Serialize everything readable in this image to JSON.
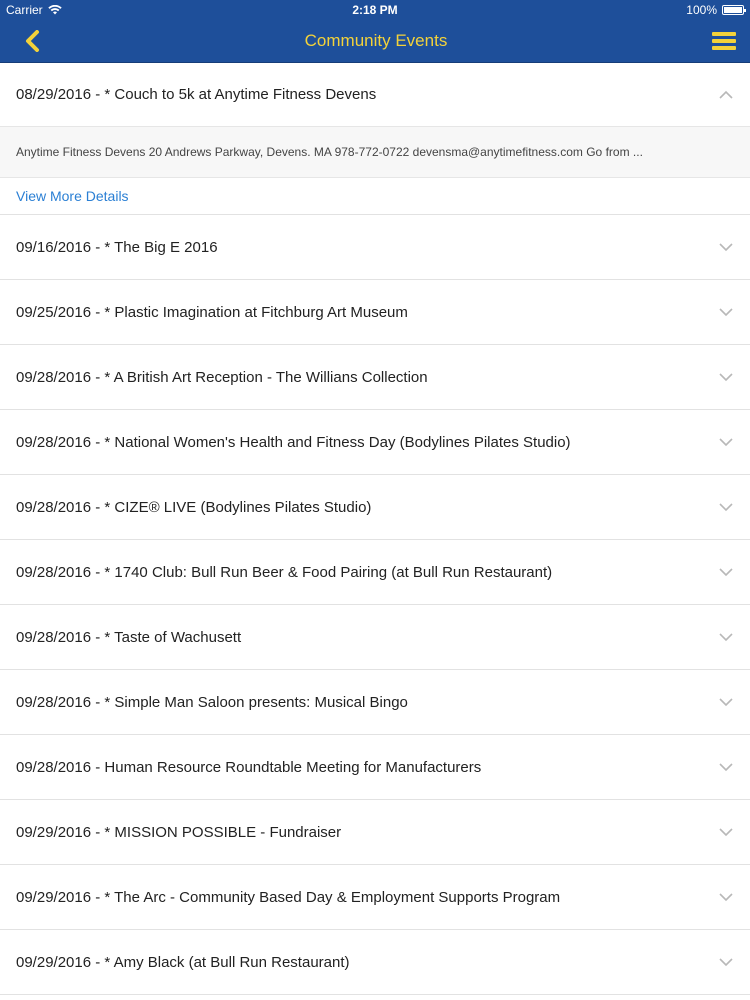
{
  "status": {
    "carrier": "Carrier",
    "time": "2:18 PM",
    "battery": "100%",
    "battery_level": 1.0
  },
  "header": {
    "title": "Community Events"
  },
  "expanded": {
    "label": "08/29/2016 - * Couch to 5k at Anytime Fitness Devens",
    "detail": "Anytime Fitness Devens 20 Andrews Parkway, Devens. MA 978-772-0722  devensma@anytimefitness.com    Go from ...",
    "more_label": "View More Details"
  },
  "events": [
    {
      "label": "09/16/2016 - * The Big E 2016"
    },
    {
      "label": "09/25/2016 - * Plastic Imagination at Fitchburg Art Museum"
    },
    {
      "label": "09/28/2016 - * A British Art Reception - The Willians Collection"
    },
    {
      "label": "09/28/2016 - * National Women's Health and Fitness Day (Bodylines Pilates Studio)"
    },
    {
      "label": "09/28/2016 - * CIZE® LIVE (Bodylines Pilates Studio)"
    },
    {
      "label": "09/28/2016 - * 1740 Club: Bull Run Beer & Food Pairing (at Bull Run Restaurant)"
    },
    {
      "label": "09/28/2016 - * Taste of Wachusett"
    },
    {
      "label": "09/28/2016 - * Simple Man Saloon presents: Musical Bingo"
    },
    {
      "label": "09/28/2016 - Human Resource Roundtable Meeting for Manufacturers"
    },
    {
      "label": "09/29/2016 - * MISSION POSSIBLE - Fundraiser"
    },
    {
      "label": "09/29/2016 - * The Arc - Community Based Day & Employment Supports Program"
    },
    {
      "label": "09/29/2016 - * Amy Black (at Bull Run Restaurant)"
    }
  ],
  "colors": {
    "bar": "#1e4f9a",
    "accent": "#f3d23a",
    "link": "#2a7fd4"
  }
}
